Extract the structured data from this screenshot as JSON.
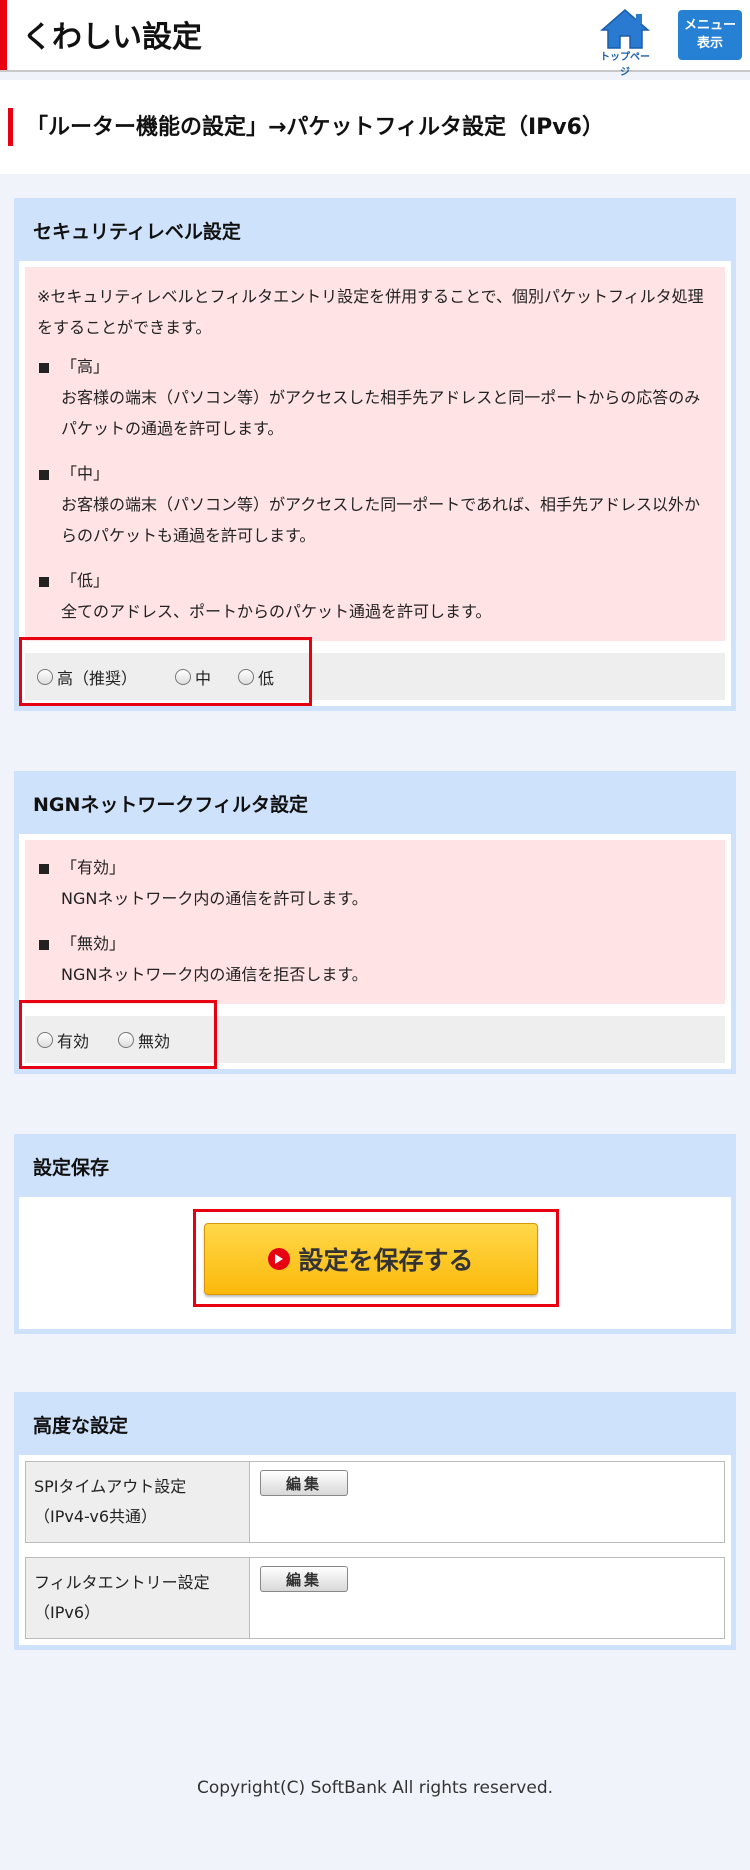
{
  "header": {
    "title": "くわしい設定",
    "home_label": "トップページ",
    "menu_line1": "メニュー",
    "menu_line2": "表示"
  },
  "page": {
    "heading": "「ルーター機能の設定」→パケットフィルタ設定（IPv6）"
  },
  "security": {
    "title": "セキュリティレベル設定",
    "note": "※セキュリティレベルとフィルタエントリ設定を併用することで、個別パケットフィルタ処理をすることができます。",
    "items": [
      {
        "head": "「高」",
        "desc": "お客様の端末（パソコン等）がアクセスした相手先アドレスと同一ポートからの応答のみパケットの通過を許可します。"
      },
      {
        "head": "「中」",
        "desc": "お客様の端末（パソコン等）がアクセスした同一ポートであれば、相手先アドレス以外からのパケットも通過を許可します。"
      },
      {
        "head": "「低」",
        "desc": "全てのアドレス、ポートからのパケット通過を許可します。"
      }
    ],
    "options": [
      "高（推奨）",
      "中",
      "低"
    ]
  },
  "ngn": {
    "title": "NGNネットワークフィルタ設定",
    "items": [
      {
        "head": "「有効」",
        "desc": "NGNネットワーク内の通信を許可します。"
      },
      {
        "head": "「無効」",
        "desc": "NGNネットワーク内の通信を拒否します。"
      }
    ],
    "options": [
      "有効",
      "無効"
    ]
  },
  "save": {
    "title": "設定保存",
    "button": "設定を保存する"
  },
  "advanced": {
    "title": "高度な設定",
    "rows": [
      {
        "line1": "SPIタイムアウト設定",
        "line2": "（IPv4-v6共通）",
        "button": "編集"
      },
      {
        "line1": "フィルタエントリー設定",
        "line2": "（IPv6）",
        "button": "編集"
      }
    ]
  },
  "footer": {
    "copyright": "Copyright(C) SoftBank All rights reserved."
  },
  "colors": {
    "accent_red": "#e60012",
    "section_blue": "#cfe2fb",
    "note_pink": "#ffe3e5",
    "menu_blue": "#2680d3"
  }
}
